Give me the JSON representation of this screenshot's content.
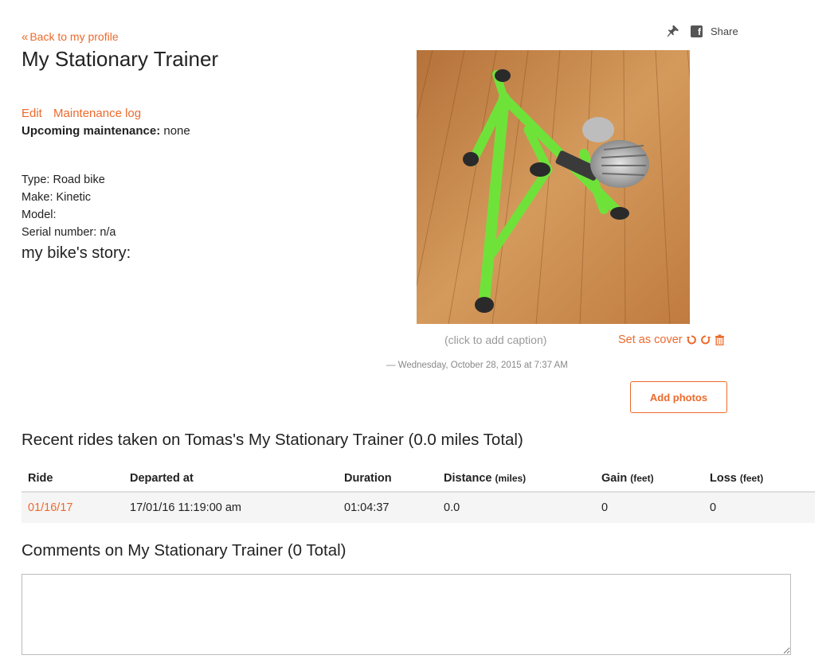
{
  "nav": {
    "back_label": "Back to my profile"
  },
  "bike": {
    "title": "My Stationary Trainer",
    "edit_label": "Edit",
    "maintenance_log_label": "Maintenance log",
    "upcoming_label": "Upcoming maintenance:",
    "upcoming_value": "none",
    "type": "Type: Road bike",
    "make": "Make: Kinetic",
    "model": "Model:",
    "serial": "Serial number: n/a",
    "story_heading": "my bike's story:"
  },
  "share": {
    "label": "Share",
    "icons": [
      "pin-icon",
      "facebook-icon"
    ]
  },
  "photo": {
    "caption_placeholder": "(click to add caption)",
    "set_cover_label": "Set as cover",
    "timestamp": "— Wednesday, October 28, 2015 at 7:37 AM",
    "action_icons": [
      "rotate-left-icon",
      "rotate-right-icon",
      "trash-icon"
    ],
    "add_photos_label": "Add photos"
  },
  "rides": {
    "heading": "Recent rides taken on Tomas's My Stationary Trainer (0.0 miles Total)",
    "columns": [
      {
        "label": "Ride",
        "unit": ""
      },
      {
        "label": "Departed at",
        "unit": ""
      },
      {
        "label": "Duration",
        "unit": ""
      },
      {
        "label": "Distance",
        "unit": "(miles)"
      },
      {
        "label": "Gain",
        "unit": "(feet)"
      },
      {
        "label": "Loss",
        "unit": "(feet)"
      }
    ],
    "rows": [
      {
        "ride": "01/16/17",
        "departed": "17/01/16 11:19:00 am",
        "duration": "01:04:37",
        "distance": "0.0",
        "gain": "0",
        "loss": "0"
      }
    ]
  },
  "comments": {
    "heading": "Comments on My Stationary Trainer (0 Total)",
    "value": ""
  },
  "colors": {
    "accent": "#ec6a2c",
    "trainer_green": "#6fe23a",
    "floor": "#c98a4a"
  }
}
